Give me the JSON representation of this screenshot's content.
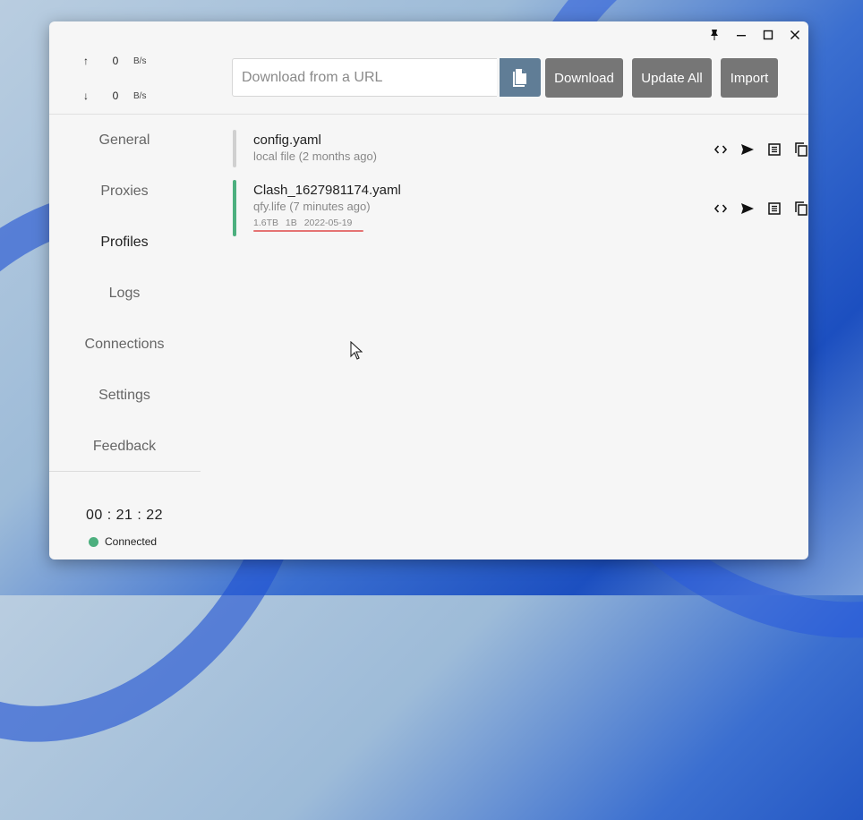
{
  "traffic": {
    "upload": {
      "arrow": "↑",
      "value": "0",
      "unit": "B/s"
    },
    "download": {
      "arrow": "↓",
      "value": "0",
      "unit": "B/s"
    }
  },
  "nav": {
    "items": [
      {
        "label": "General",
        "active": false
      },
      {
        "label": "Proxies",
        "active": false
      },
      {
        "label": "Profiles",
        "active": true
      },
      {
        "label": "Logs",
        "active": false
      },
      {
        "label": "Connections",
        "active": false
      },
      {
        "label": "Settings",
        "active": false
      },
      {
        "label": "Feedback",
        "active": false
      }
    ]
  },
  "footer": {
    "timer": "00 : 21 : 22",
    "status": "Connected",
    "status_color": "#4caf7e"
  },
  "toolbar": {
    "url_placeholder": "Download from a URL",
    "download_label": "Download",
    "update_all_label": "Update All",
    "import_label": "Import"
  },
  "profiles": [
    {
      "name": "config.yaml",
      "sub": "local file (2 months ago)",
      "meta": "",
      "selected": false,
      "bar_color": "#d0d0d0"
    },
    {
      "name": "Clash_1627981174.yaml",
      "sub": "qfy.life (7 minutes ago)",
      "meta": "1.6TB  1B  2022-05-19",
      "selected": true,
      "bar_color": "#4caf7e"
    }
  ],
  "profile_actions": [
    "code-icon",
    "send-icon",
    "list-icon",
    "copy-icon",
    "qr-code-icon",
    "split-icon",
    "gear-icon",
    "refresh-icon",
    "close-icon"
  ],
  "window_controls": [
    "pin-icon",
    "minimize-icon",
    "maximize-icon",
    "close-icon"
  ]
}
